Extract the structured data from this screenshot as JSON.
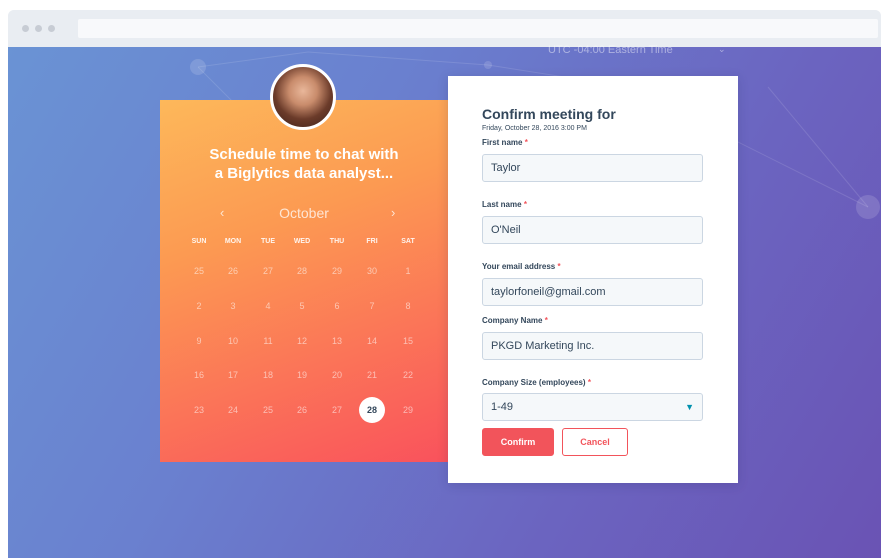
{
  "timezone": {
    "label": "UTC -04:00 Eastern Time"
  },
  "scheduler": {
    "headline_line1": "Schedule time to chat with",
    "headline_line2": "a Biglytics data analyst...",
    "month": "October",
    "prev_symbol": "‹",
    "next_symbol": "›",
    "weekdays": [
      "SUN",
      "MON",
      "TUE",
      "WED",
      "THU",
      "FRI",
      "SAT"
    ],
    "weeks": [
      [
        "25",
        "26",
        "27",
        "28",
        "29",
        "30",
        "1"
      ],
      [
        "2",
        "3",
        "4",
        "5",
        "6",
        "7",
        "8"
      ],
      [
        "9",
        "10",
        "11",
        "12",
        "13",
        "14",
        "15"
      ],
      [
        "16",
        "17",
        "18",
        "19",
        "20",
        "21",
        "22"
      ],
      [
        "23",
        "24",
        "25",
        "26",
        "27",
        "28",
        "29"
      ]
    ],
    "selected_day": "28"
  },
  "form": {
    "title": "Confirm meeting for",
    "datetime": "Friday, October 28, 2016 3:00 PM",
    "fields": [
      {
        "label": "First name",
        "value": "Taylor"
      },
      {
        "label": "Last name",
        "value": "O'Neil"
      },
      {
        "label": "Your email address",
        "value": "taylorfoneil@gmail.com"
      },
      {
        "label": "Company Name",
        "value": "PKGD Marketing Inc."
      },
      {
        "label": "Company Size (employees)",
        "value": "1-49"
      }
    ],
    "required_marker": "*",
    "confirm_label": "Confirm",
    "cancel_label": "Cancel"
  },
  "colors": {
    "accent": "#f2545b",
    "text": "#33475b",
    "select_caret": "#0091ae"
  }
}
